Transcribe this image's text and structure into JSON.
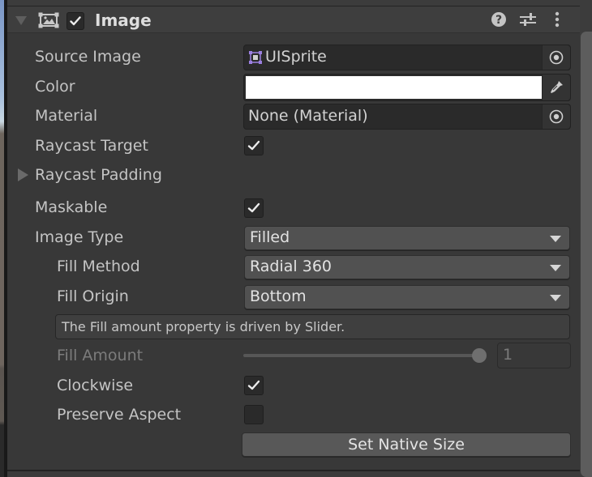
{
  "component": {
    "title": "Image",
    "enabled": true,
    "icon": "image-component-icon",
    "header_icons": [
      "help-icon",
      "presets-icon",
      "kebab-menu-icon"
    ]
  },
  "properties": {
    "source_image": {
      "label": "Source Image",
      "value": "UISprite",
      "icon": "sprite-icon",
      "picker_icon": "object-picker-icon"
    },
    "color": {
      "label": "Color",
      "value": "#ffffff",
      "picker_icon": "eyedropper-icon"
    },
    "material": {
      "label": "Material",
      "value": "None (Material)",
      "picker_icon": "object-picker-icon"
    },
    "raycast_target": {
      "label": "Raycast Target",
      "checked": true
    },
    "raycast_padding": {
      "label": "Raycast Padding",
      "expanded": false
    },
    "maskable": {
      "label": "Maskable",
      "checked": true
    },
    "image_type": {
      "label": "Image Type",
      "value": "Filled"
    },
    "fill_method": {
      "label": "Fill Method",
      "value": "Radial 360"
    },
    "fill_origin": {
      "label": "Fill Origin",
      "value": "Bottom"
    },
    "help_message": "The Fill amount property is driven by Slider.",
    "fill_amount": {
      "label": "Fill Amount",
      "value": "1",
      "slider_fraction": 1.0,
      "disabled": true
    },
    "clockwise": {
      "label": "Clockwise",
      "checked": true
    },
    "preserve_aspect": {
      "label": "Preserve Aspect",
      "checked": false
    }
  },
  "buttons": {
    "set_native_size": "Set Native Size"
  },
  "colors": {
    "panel_bg": "#383838",
    "sprite_icon": "#9b7fe0"
  }
}
